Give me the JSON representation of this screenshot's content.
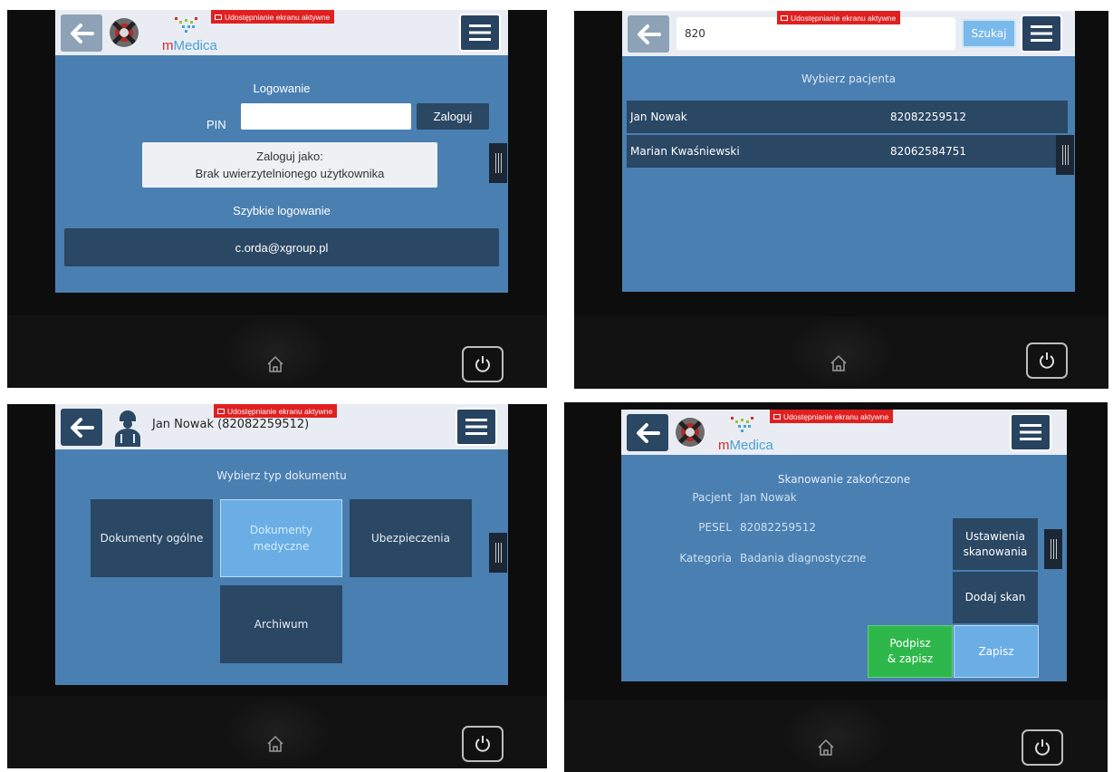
{
  "share_badge": "Udostępnianie ekranu aktywne",
  "brand": {
    "logo_text_m": "m",
    "logo_text_rest": "Medica"
  },
  "panel1": {
    "title": "Logowanie",
    "pin_label": "PIN",
    "pin_value": "",
    "login_button": "Zaloguj",
    "login_as_line1": "Zaloguj jako:",
    "login_as_line2": "Brak uwierzytelnionego użytkownika",
    "quick_login_title": "Szybkie logowanie",
    "quick_login_user": "c.orda@xgroup.pl"
  },
  "panel2": {
    "search_value": "820",
    "search_button": "Szukaj",
    "title": "Wybierz pacjenta",
    "patients": [
      {
        "name": "Jan Nowak",
        "pesel": "82082259512"
      },
      {
        "name": "Marian Kwaśniewski",
        "pesel": "82062584751"
      }
    ]
  },
  "panel3": {
    "patient_header": "Jan Nowak (82082259512)",
    "title": "Wybierz typ dokumentu",
    "doc_types": [
      {
        "label": "Dokumenty ogólne"
      },
      {
        "label": "Dokumenty medyczne"
      },
      {
        "label": "Ubezpieczenia"
      },
      {
        "label": "Archiwum"
      }
    ]
  },
  "panel4": {
    "title": "Skanowanie zakończone",
    "fields": [
      {
        "label": "Pacjent",
        "value": "Jan Nowak"
      },
      {
        "label": "PESEL",
        "value": "82082259512"
      },
      {
        "label": "Kategoria",
        "value": "Badania diagnostyczne"
      }
    ],
    "scan_settings_button": "Ustawienia skanowania",
    "add_scan_button": "Dodaj skan",
    "sign_save_button": "Podpisz & zapisz",
    "save_button": "Zapisz"
  },
  "colors": {
    "screen_bg": "#4a7fb2",
    "tile_dark": "#2a4764",
    "tile_active": "#6aaee5",
    "sign_green": "#2eb84b",
    "badge_red": "#e02020"
  },
  "icons": [
    "back-arrow-icon",
    "menu-icon",
    "home-icon",
    "power-icon",
    "robot-logo-icon",
    "mmedica-logo-icon",
    "patient-avatar-icon",
    "grip-handle-icon"
  ]
}
